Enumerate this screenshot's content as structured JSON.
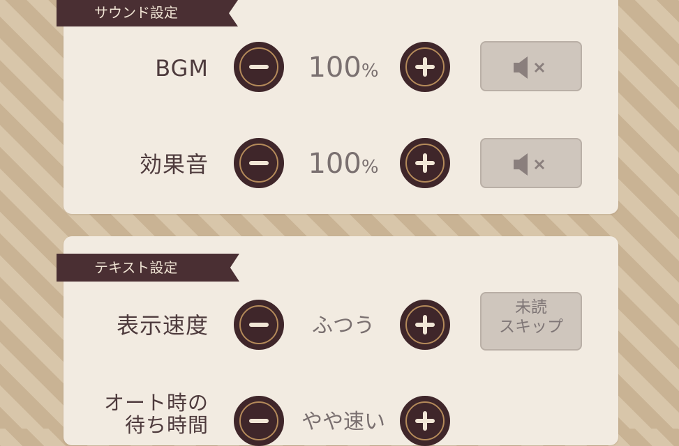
{
  "sections": {
    "sound": {
      "title": "サウンド設定",
      "rows": [
        {
          "label": "BGM",
          "value": "100",
          "unit": "%",
          "mute_icon": "speaker-mute-icon"
        },
        {
          "label": "効果音",
          "value": "100",
          "unit": "%",
          "mute_icon": "speaker-mute-icon"
        }
      ]
    },
    "text": {
      "title": "テキスト設定",
      "rows": [
        {
          "label": "表示速度",
          "value": "ふつう",
          "side_button_line1": "未読",
          "side_button_line2": "スキップ"
        },
        {
          "label_line1": "オート時の",
          "label_line2": "待ち時間",
          "value": "やや速い"
        }
      ]
    }
  },
  "colors": {
    "panel": "#f2ebe1",
    "ribbon": "#4a2f33",
    "button_dark": "#3f262a",
    "button_ring": "#b48a5a",
    "toggle_button": "#cfc6bd"
  }
}
